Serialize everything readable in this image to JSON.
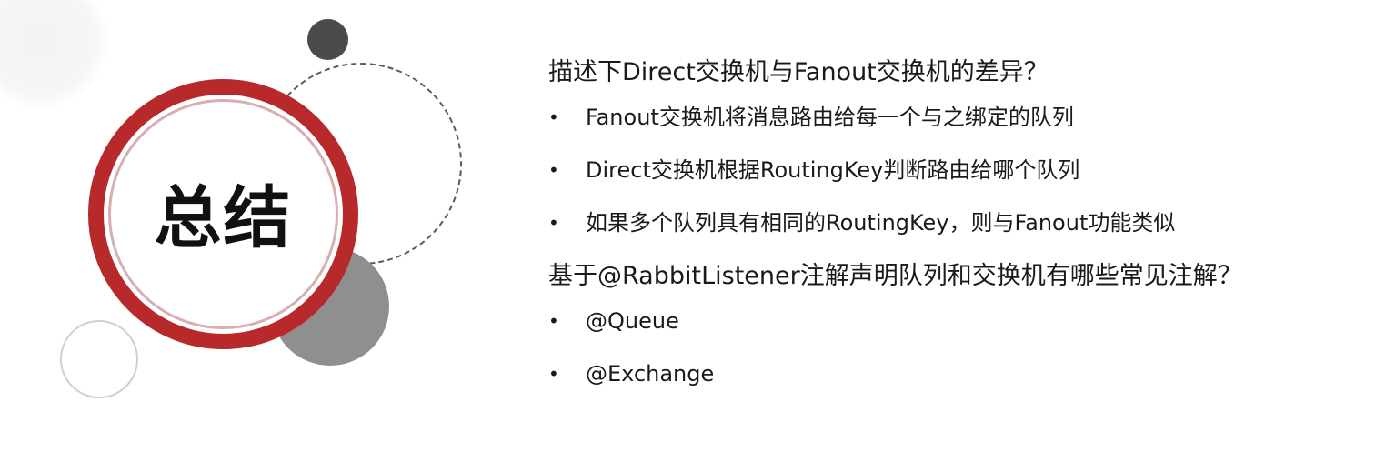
{
  "left_panel": {
    "title": "总结"
  },
  "sections": [
    {
      "question": "描述下Direct交换机与Fanout交换机的差异？",
      "bullet_glyph": "•",
      "items": [
        "Fanout交换机将消息路由给每一个与之绑定的队列",
        "Direct交换机根据RoutingKey判断路由给哪个队列",
        "如果多个队列具有相同的RoutingKey，则与Fanout功能类似"
      ]
    },
    {
      "question": "基于@RabbitListener注解声明队列和交换机有哪些常见注解？",
      "bullet_glyph": "•",
      "items": [
        "@Queue",
        "@Exchange"
      ]
    }
  ],
  "colors": {
    "ring": "#b8292c",
    "dark_dot": "#4b4b4b",
    "gray_circle": "#8f8f8f",
    "text": "#1a1a1a"
  }
}
